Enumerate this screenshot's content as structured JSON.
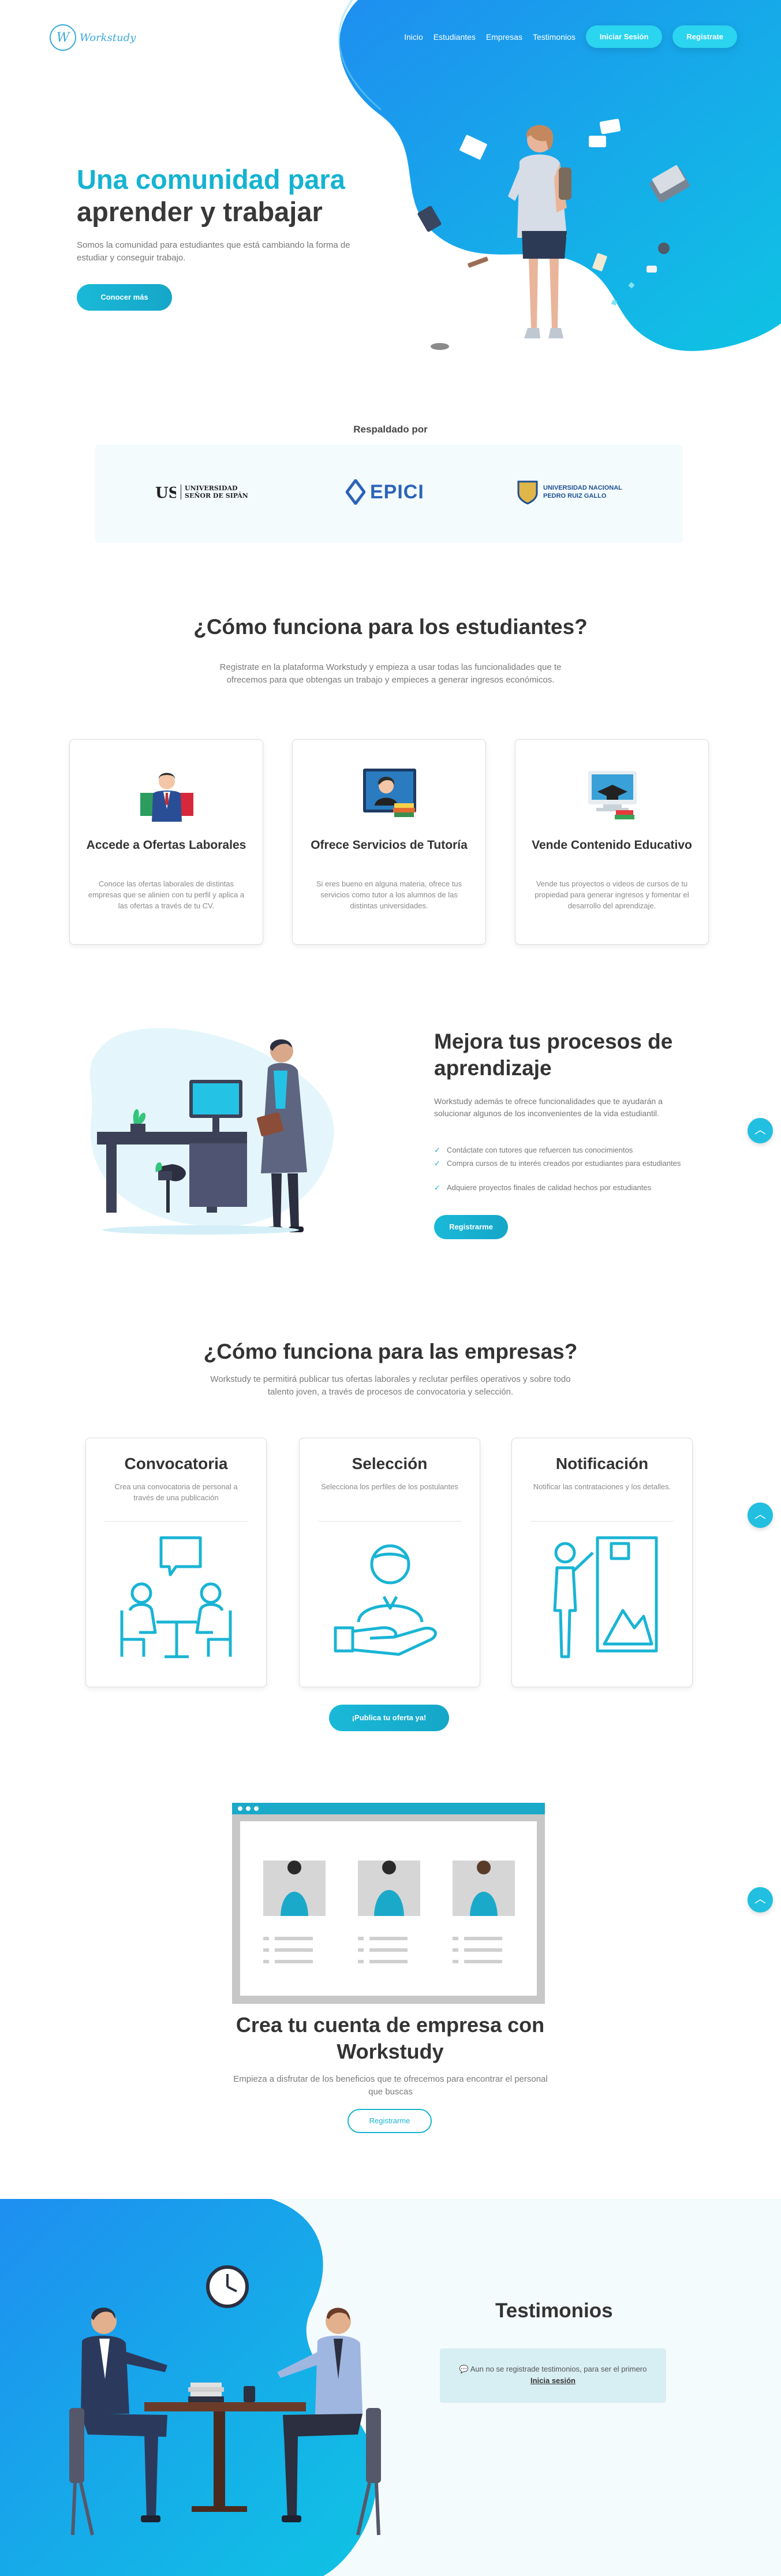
{
  "brand": {
    "mark": "W",
    "name": "Workstudy"
  },
  "nav": {
    "items": [
      "Inicio",
      "Estudiantes",
      "Empresas",
      "Testimonios"
    ],
    "login": "Iniciar Sesión",
    "register": "Registrate"
  },
  "hero": {
    "title_line1": "Una comunidad para",
    "title_line2": "aprender y trabajar",
    "subtitle": "Somos la comunidad para estudiantes que está cambiando la forma de estudiar y conseguir trabajo.",
    "cta": "Conocer más"
  },
  "backed": {
    "title": "Respaldado por",
    "partners": [
      {
        "name": "UNIVERSIDAD SEÑOR DE SIPÁN"
      },
      {
        "name": "EPICI"
      },
      {
        "name": "UNIVERSIDAD NACIONAL PEDRO RUIZ GALLO"
      }
    ]
  },
  "students": {
    "title": "¿Cómo funciona para los estudiantes?",
    "subtitle": "Registrate en la plataforma Workstudy y empieza a usar todas las funcionalidades que te ofrecemos para que obtengas un trabajo y empieces a generar ingresos económicos.",
    "cards": [
      {
        "title": "Accede a Ofertas Laborales",
        "text": "Conoce las ofertas laborales de distintas empresas que se alinien con tu perfil y aplica a las ofertas a través de tu CV."
      },
      {
        "title": "Ofrece Servicios de Tutoría",
        "text": "Si eres bueno en alguna materia, ofrece tus servicios como tutor a los alumnos de las distintas universidades."
      },
      {
        "title": "Vende Contenido Educativo",
        "text": "Vende tus proyectos o videos de cursos de tu propiedad para generar ingresos y fomentar el desarrollo del aprendizaje."
      }
    ]
  },
  "improve": {
    "title": "Mejora tus procesos de aprendizaje",
    "text": "Workstudy además te ofrece funcionalidades que te ayudarán a solucionar algunos de los inconvenientes de la vida estudiantil.",
    "checks": [
      "Contáctate con tutores que refuercen tus conocimientos",
      "Compra cursos de tu interés creados por estudiantes para estudiantes",
      "Adquiere proyectos finales de calidad hechos por estudiantes"
    ],
    "cta": "Registrarme"
  },
  "companies": {
    "title": "¿Cómo funciona para las empresas?",
    "subtitle": "Workstudy te permitirá publicar tus ofertas laborales y reclutar perfiles operativos y sobre todo talento joven, a través de procesos de convocatoria y selección.",
    "cards": [
      {
        "title": "Convocatoria",
        "text": "Crea una convocatoria de personal a través de una publicación"
      },
      {
        "title": "Selección",
        "text": "Selecciona los perfiles de los postulantes"
      },
      {
        "title": "Notificación",
        "text": "Notificar las contrataciones y los detalles."
      }
    ],
    "cta": "¡Publica tu oferta ya!"
  },
  "create_account": {
    "title": "Crea tu cuenta de empresa con Workstudy",
    "text": "Empieza a disfrutar de los beneficios que te ofrecemos para encontrar el personal que buscas",
    "cta": "Registrarme"
  },
  "testimonials": {
    "title": "Testimonios",
    "notice": "Aun no se registrade testimonios, para ser el primero",
    "link": "Inicia sesión"
  },
  "colors": {
    "accent": "#14b3d2",
    "accent_light": "#2bd4ef",
    "blob": "#19a8e8"
  },
  "icons": {
    "scroll_top": "chevron-up-icon",
    "check": "check-icon",
    "comment": "comment-icon"
  }
}
